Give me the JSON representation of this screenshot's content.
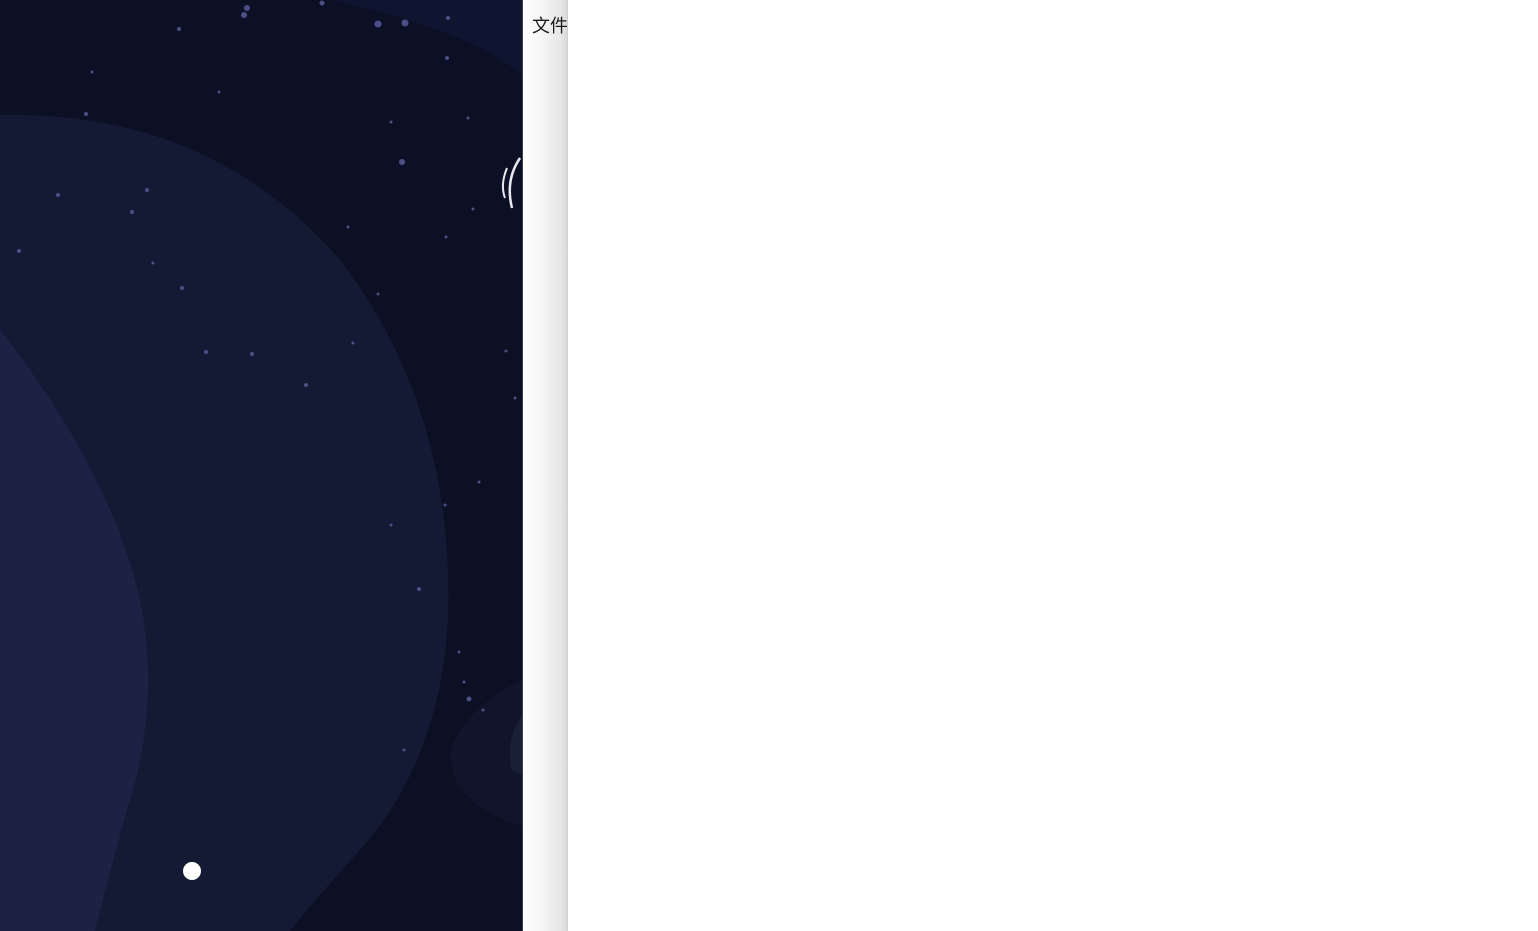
{
  "sidebar": {
    "file_label": "文件"
  },
  "scene": {
    "background_color": "#0c1024",
    "planet_outer_color": "#141a33",
    "planet_inner_color": "#1b2244",
    "star_color": "#4a4f86",
    "bright_star_color": "#ffffff",
    "icons": [
      "planet-shape",
      "moon-dot",
      "star-field",
      "comet-arcs"
    ]
  },
  "main": {
    "background_color": "#ffffff"
  }
}
